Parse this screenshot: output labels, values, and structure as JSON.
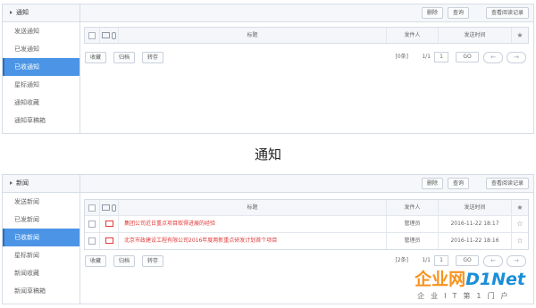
{
  "panel_notice": {
    "sidebar_header": "通知",
    "sidebar_items": [
      "发送通知",
      "已发通知",
      "已收通知",
      "星标通知",
      "通知收藏",
      "通知草稿箱"
    ],
    "active_index": 2,
    "toolbar": {
      "delete": "删除",
      "search": "查询",
      "read_log": "查看阅读记录"
    },
    "table_headers": {
      "title": "标题",
      "sender": "发件人",
      "send_time": "发送时间",
      "star": "★"
    },
    "rows": [],
    "actions": {
      "collect": "收藏",
      "archive": "归档",
      "forward": "转存"
    },
    "pager": {
      "count": "[0条]",
      "page_of": "1/1",
      "page_input": "1",
      "go": "GO"
    }
  },
  "caption": "通知",
  "panel_news": {
    "sidebar_header": "新闻",
    "sidebar_items": [
      "发送新闻",
      "已发新闻",
      "已收新闻",
      "星标新闻",
      "新闻收藏",
      "新闻草稿箱"
    ],
    "active_index": 2,
    "toolbar": {
      "delete": "删除",
      "search": "查询",
      "read_log": "查看阅读记录"
    },
    "table_headers": {
      "title": "标题",
      "sender": "发件人",
      "send_time": "发送时间",
      "star": "★"
    },
    "rows": [
      {
        "title": "集团公司近日重点项目取得进展的经验",
        "sender": "管理员",
        "time": "2016-11-22 18:17",
        "star": "☆"
      },
      {
        "title": "北京市政建设工程有限公司2016年度两新重点研发计划首个项目",
        "sender": "管理员",
        "time": "2016-11-22 18:16",
        "star": "☆"
      }
    ],
    "actions": {
      "collect": "收藏",
      "archive": "归档",
      "forward": "转存"
    },
    "pager": {
      "count": "[2条]",
      "page_of": "1/1",
      "page_input": "1",
      "go": "GO"
    }
  },
  "watermark": {
    "brand_a": "企业网",
    "brand_b": "D1Net",
    "tagline": "企业IT第1门户"
  },
  "icons": {
    "mail": "envelope-icon",
    "attachment": "paperclip-icon",
    "star": "star-icon",
    "prev": "arrow-left-icon",
    "next": "arrow-right-icon",
    "expand": "triangle-right-icon"
  },
  "colors": {
    "active": "#4c95e6",
    "link_red": "#e03a3a",
    "brand_orange": "#f7931e",
    "brand_blue": "#1a8fd8"
  }
}
